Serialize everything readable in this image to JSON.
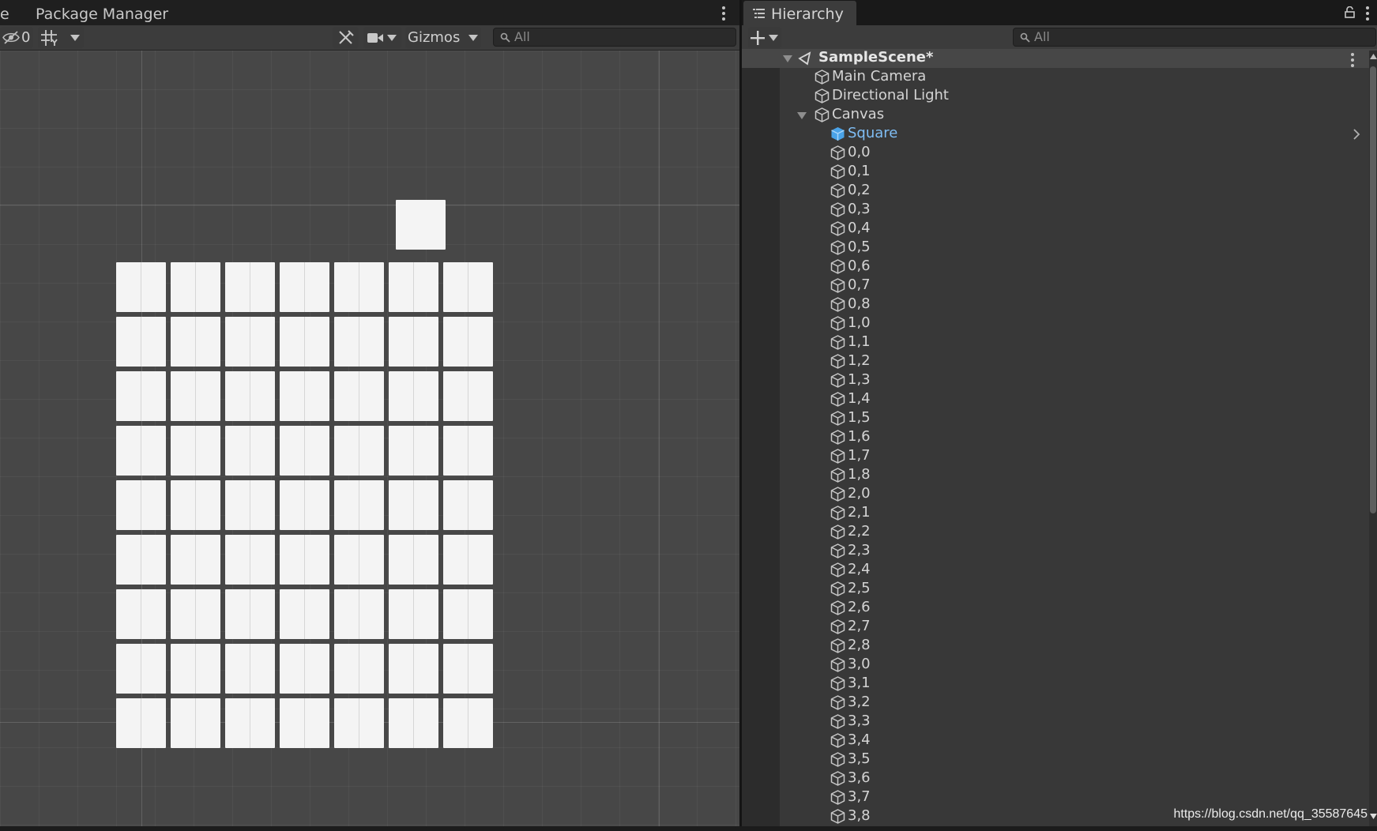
{
  "scene_panel": {
    "partial_tab_label": "e",
    "tab_label": "Package Manager",
    "toolbar": {
      "hidden_count": "0",
      "gizmos_label": "Gizmos",
      "search_placeholder": "All"
    }
  },
  "viewport": {
    "grid_rows": 9,
    "grid_cols": 7,
    "tile_color": "#f4f4f4",
    "background_color": "#474747"
  },
  "hierarchy": {
    "tab_label": "Hierarchy",
    "search_placeholder": "All",
    "scene_name": "SampleScene*",
    "root_items": [
      "Main Camera",
      "Directional Light",
      "Canvas"
    ],
    "canvas_children": [
      "Square",
      "0,0",
      "0,1",
      "0,2",
      "0,3",
      "0,4",
      "0,5",
      "0,6",
      "0,7",
      "0,8",
      "1,0",
      "1,1",
      "1,2",
      "1,3",
      "1,4",
      "1,5",
      "1,6",
      "1,7",
      "1,8",
      "2,0",
      "2,1",
      "2,2",
      "2,3",
      "2,4",
      "2,5",
      "2,6",
      "2,7",
      "2,8",
      "3,0",
      "3,1",
      "3,2",
      "3,3",
      "3,4",
      "3,5",
      "3,6",
      "3,7",
      "3,8"
    ],
    "selected_item": "Square",
    "selected_color": "#7fbdf4"
  },
  "watermark": "https://blog.csdn.net/qq_35587645"
}
